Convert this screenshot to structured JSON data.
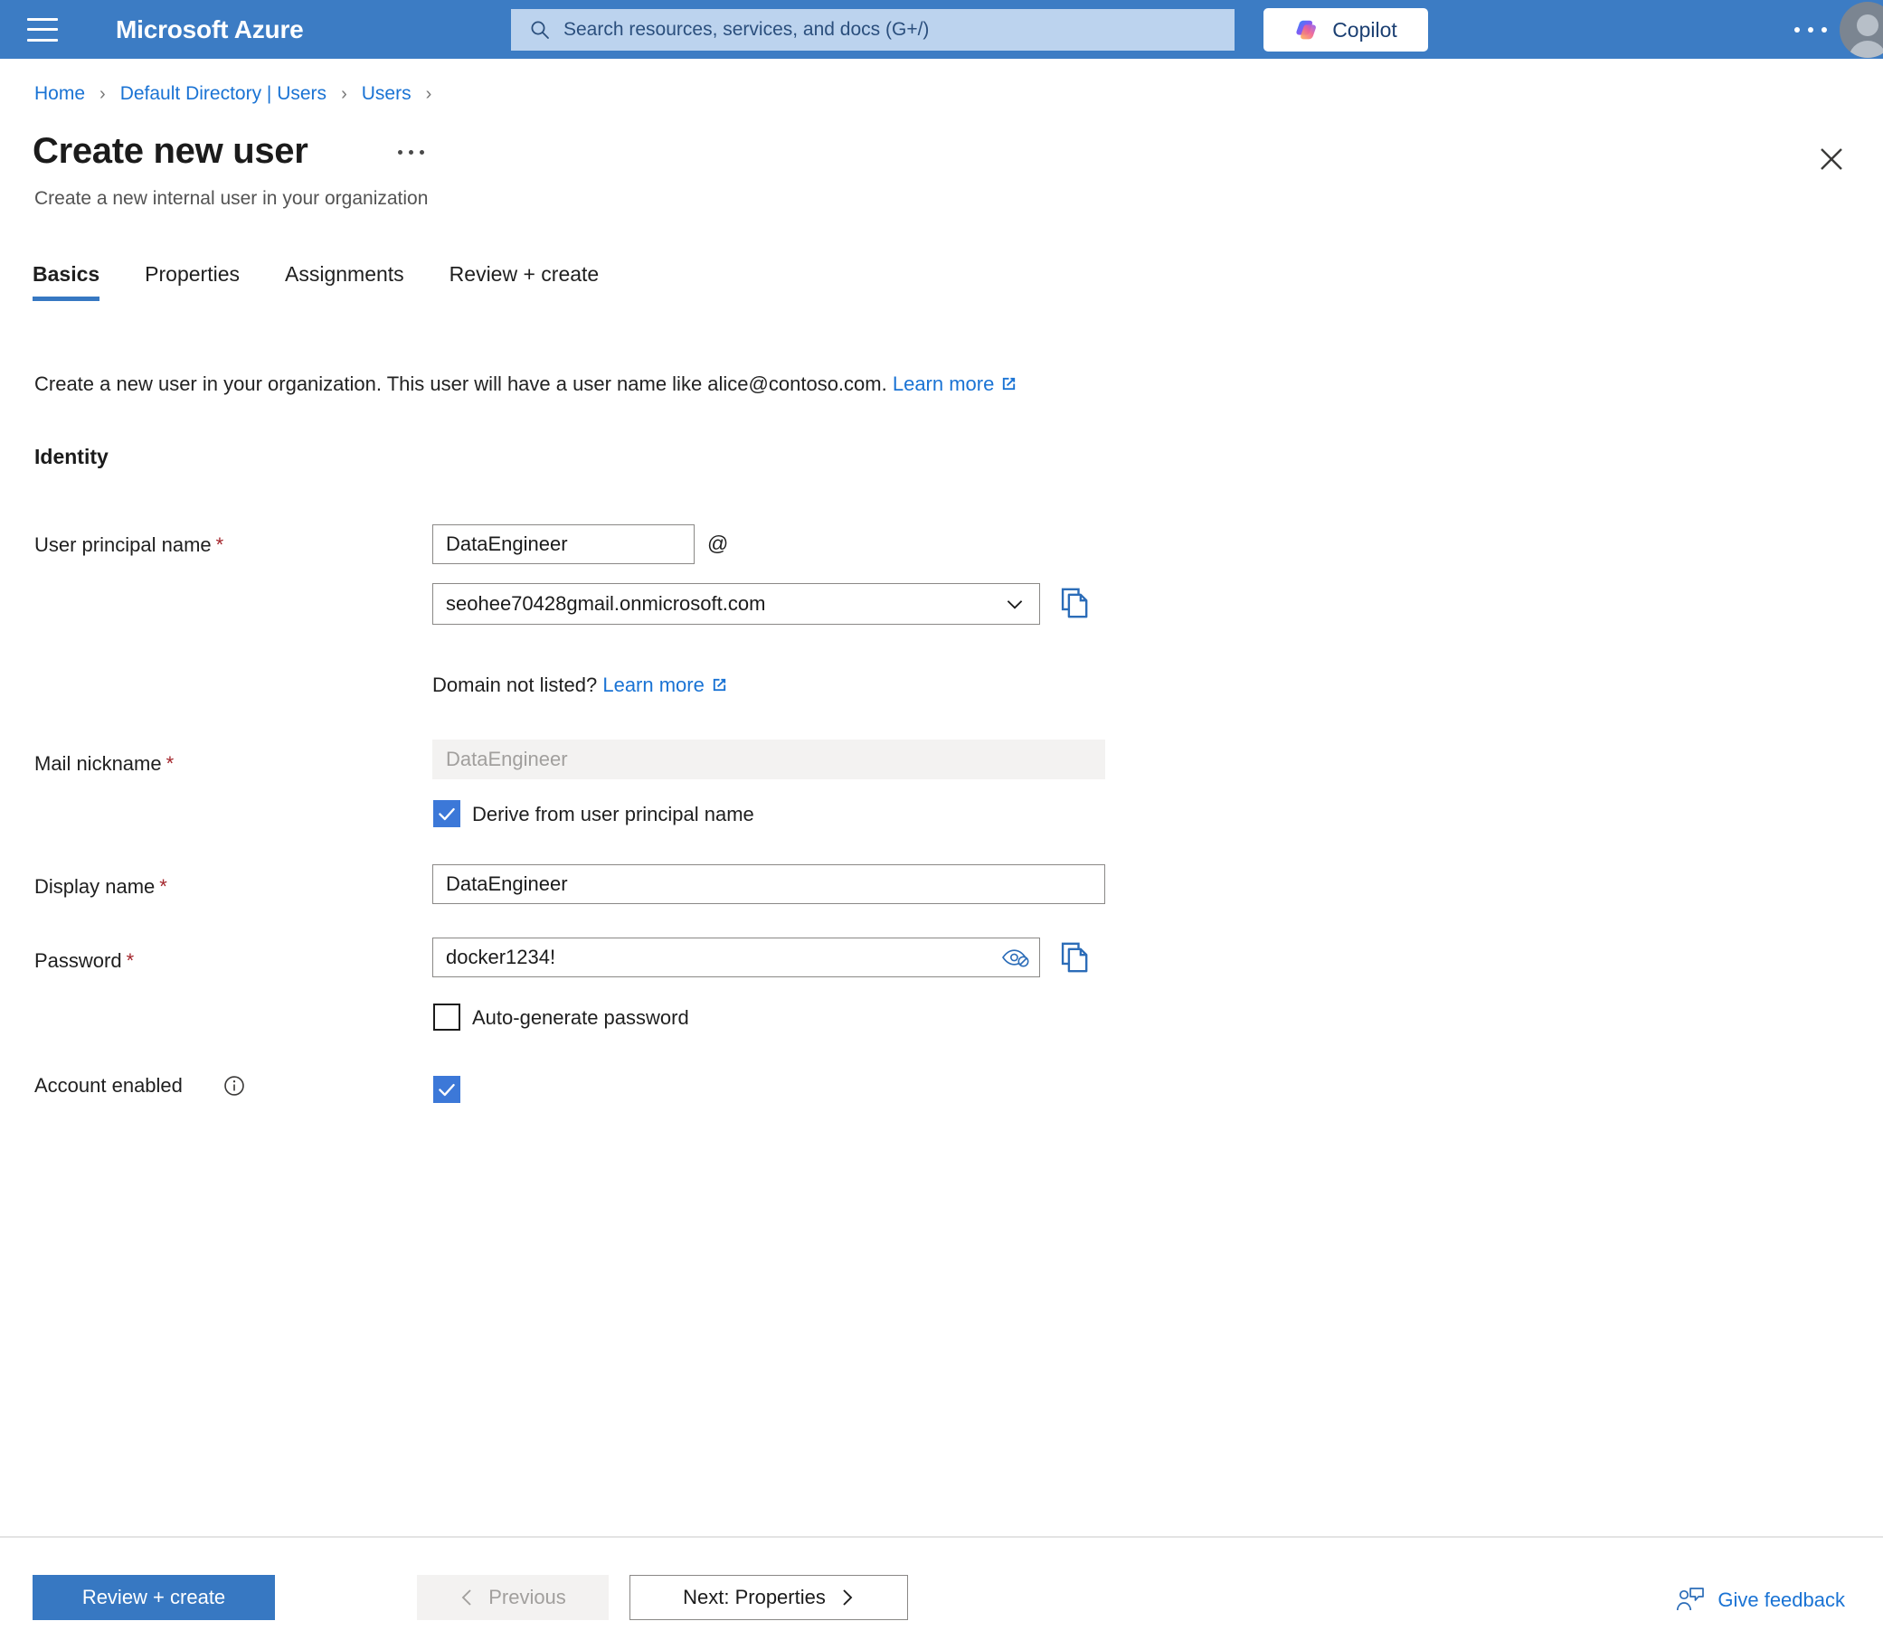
{
  "topnav": {
    "menu_icon": "hamburger-icon",
    "brand": "Microsoft Azure",
    "search": {
      "icon": "search-icon",
      "placeholder": "Search resources, services, and docs (G+/)",
      "value": ""
    },
    "copilot_label": "Copilot",
    "copilot_icon": "copilot-icon",
    "more_icon": "ellipsis-icon",
    "avatar_icon": "account-avatar",
    "background_color": "#3c7cc4",
    "search_background_color": "#bcd3ee"
  },
  "breadcrumb": {
    "items": [
      {
        "label": "Home"
      },
      {
        "label": "Default Directory | Users"
      },
      {
        "label": "Users"
      }
    ],
    "separator": "›",
    "link_color": "#1a73d4"
  },
  "blade": {
    "title": "Create new user",
    "title_more_icon": "ellipsis-icon",
    "subtitle": "Create a new internal user in your organization",
    "close_icon": "close-icon"
  },
  "tabs": [
    {
      "label": "Basics",
      "active": true
    },
    {
      "label": "Properties",
      "active": false
    },
    {
      "label": "Assignments",
      "active": false
    },
    {
      "label": "Review + create",
      "active": false
    }
  ],
  "tab_accent_color": "#3778c2",
  "intro": {
    "text": "Create a new user in your organization. This user will have a user name like alice@contoso.com.",
    "link_label": "Learn more",
    "link_icon": "external-link-icon"
  },
  "form": {
    "section_title": "Identity",
    "required_marker": "*",
    "upn": {
      "label": "User principal name",
      "required": true,
      "prefix_value": "DataEngineer",
      "prefix_placeholder": "",
      "at_symbol": "@",
      "domain_value": "seohee70428gmail.onmicrosoft.com",
      "domain_chevron_icon": "chevron-down-icon",
      "copy_icon": "copy-icon",
      "domain_hint_text": "Domain not listed?",
      "domain_hint_link": "Learn more",
      "domain_hint_link_icon": "external-link-icon"
    },
    "mail_nickname": {
      "label": "Mail nickname",
      "required": true,
      "value": "",
      "placeholder": "DataEngineer",
      "readonly": true,
      "checkbox_label": "Derive from user principal name",
      "checkbox_checked": true
    },
    "display_name": {
      "label": "Display name",
      "required": true,
      "value": "DataEngineer"
    },
    "password": {
      "label": "Password",
      "required": true,
      "value": "docker1234!",
      "reveal_icon": "eye-off-icon",
      "copy_icon": "copy-icon",
      "checkbox_label": "Auto-generate password",
      "checkbox_checked": false
    },
    "account_enabled": {
      "label": "Account enabled",
      "info_icon": "info-icon",
      "checked": true
    },
    "checkbox_color": "#3c78d8",
    "required_color": "#a4262c"
  },
  "footer": {
    "review_create_label": "Review + create",
    "previous_label": "Previous",
    "previous_icon": "chevron-left-icon",
    "previous_disabled": true,
    "next_label": "Next: Properties",
    "next_icon": "chevron-right-icon",
    "feedback_label": "Give feedback",
    "feedback_icon": "feedback-person-icon",
    "primary_color": "#3778c2"
  }
}
